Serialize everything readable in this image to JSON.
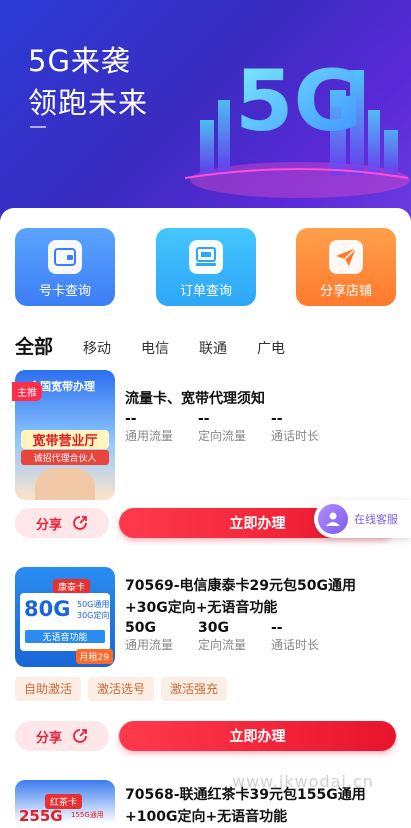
{
  "banner": {
    "title_line1": "5G来袭",
    "title_line2": "领跑未来",
    "art_text": "5G"
  },
  "quick_actions": [
    {
      "label": "号卡查询",
      "icon": "sim-card-icon"
    },
    {
      "label": "订单查询",
      "icon": "order-icon"
    },
    {
      "label": "分享店铺",
      "icon": "send-icon"
    }
  ],
  "tabs": [
    "全部",
    "移动",
    "电信",
    "联通",
    "广电"
  ],
  "products": [
    {
      "badge": "主推",
      "thumb_heading": "全国宽带办理",
      "thumb_sub": "宽带营业厅",
      "thumb_sub2": "诚招代理合伙人",
      "title": "流量卡、宽带代理须知",
      "stats": [
        {
          "value": "--",
          "label": "通用流量"
        },
        {
          "value": "--",
          "label": "定向流量"
        },
        {
          "value": "--",
          "label": "通话时长"
        }
      ],
      "share_label": "分享",
      "apply_label": "立即办理"
    },
    {
      "thumb_card": "康泰卡",
      "thumb_flow": "80G",
      "thumb_note1": "50G通用",
      "thumb_note2": "30G定向",
      "thumb_voice": "无语音功能",
      "thumb_price": "月租29",
      "title": "70569-电信康泰卡29元包50G通用+30G定向+无语音功能",
      "stats": [
        {
          "value": "50G",
          "label": "通用流量"
        },
        {
          "value": "30G",
          "label": "定向流量"
        },
        {
          "value": "--",
          "label": "通话时长"
        }
      ],
      "tags": [
        "自助激活",
        "激活选号",
        "激活强充"
      ],
      "share_label": "分享",
      "apply_label": "立即办理"
    },
    {
      "thumb_card": "红茶卡",
      "thumb_flow": "255G",
      "thumb_note1": "155G通用",
      "title": "70568-联通红茶卡39元包155G通用+100G定向+无语音功能"
    }
  ],
  "customer_service": {
    "label": "在线客服"
  },
  "watermark": "www.jkwodai.cn",
  "colors": {
    "accent": "#e8142c",
    "tab_underline": "#ffd23c",
    "tag_bg": "#fdeee5"
  }
}
